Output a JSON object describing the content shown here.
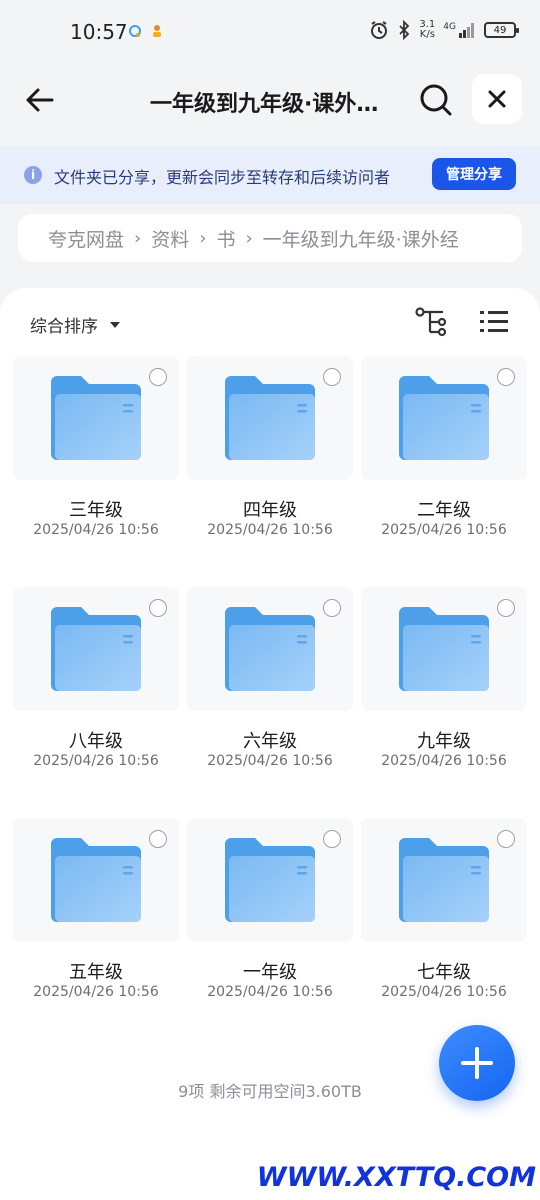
{
  "status_bar": {
    "time": "10:57",
    "net_speed_value": "3.1",
    "net_speed_unit": "K/s",
    "network": "4G",
    "battery": "49"
  },
  "header": {
    "title": "一年级到九年级·课外经典读物"
  },
  "share_banner": {
    "text": "文件夹已分享，更新会同步至转存和后续访问者",
    "button_label": "管理分享"
  },
  "breadcrumb": {
    "items": [
      "夸克网盘",
      "资料",
      "书",
      "一年级到九年级·课外经"
    ]
  },
  "toolbar": {
    "sort_label": "综合排序"
  },
  "folders": [
    {
      "name": "三年级",
      "date": "2025/04/26 10:56"
    },
    {
      "name": "四年级",
      "date": "2025/04/26 10:56"
    },
    {
      "name": "二年级",
      "date": "2025/04/26 10:56"
    },
    {
      "name": "八年级",
      "date": "2025/04/26 10:56"
    },
    {
      "name": "六年级",
      "date": "2025/04/26 10:56"
    },
    {
      "name": "九年级",
      "date": "2025/04/26 10:56"
    },
    {
      "name": "五年级",
      "date": "2025/04/26 10:56"
    },
    {
      "name": "一年级",
      "date": "2025/04/26 10:56"
    },
    {
      "name": "七年级",
      "date": "2025/04/26 10:56"
    }
  ],
  "summary": "9项 剩余可用空间3.60TB",
  "watermark": "WWW.XXTTQ.COM",
  "colors": {
    "accent": "#1a56e8",
    "folder": "#5aa8f0",
    "banner_bg": "#e8eefc"
  }
}
